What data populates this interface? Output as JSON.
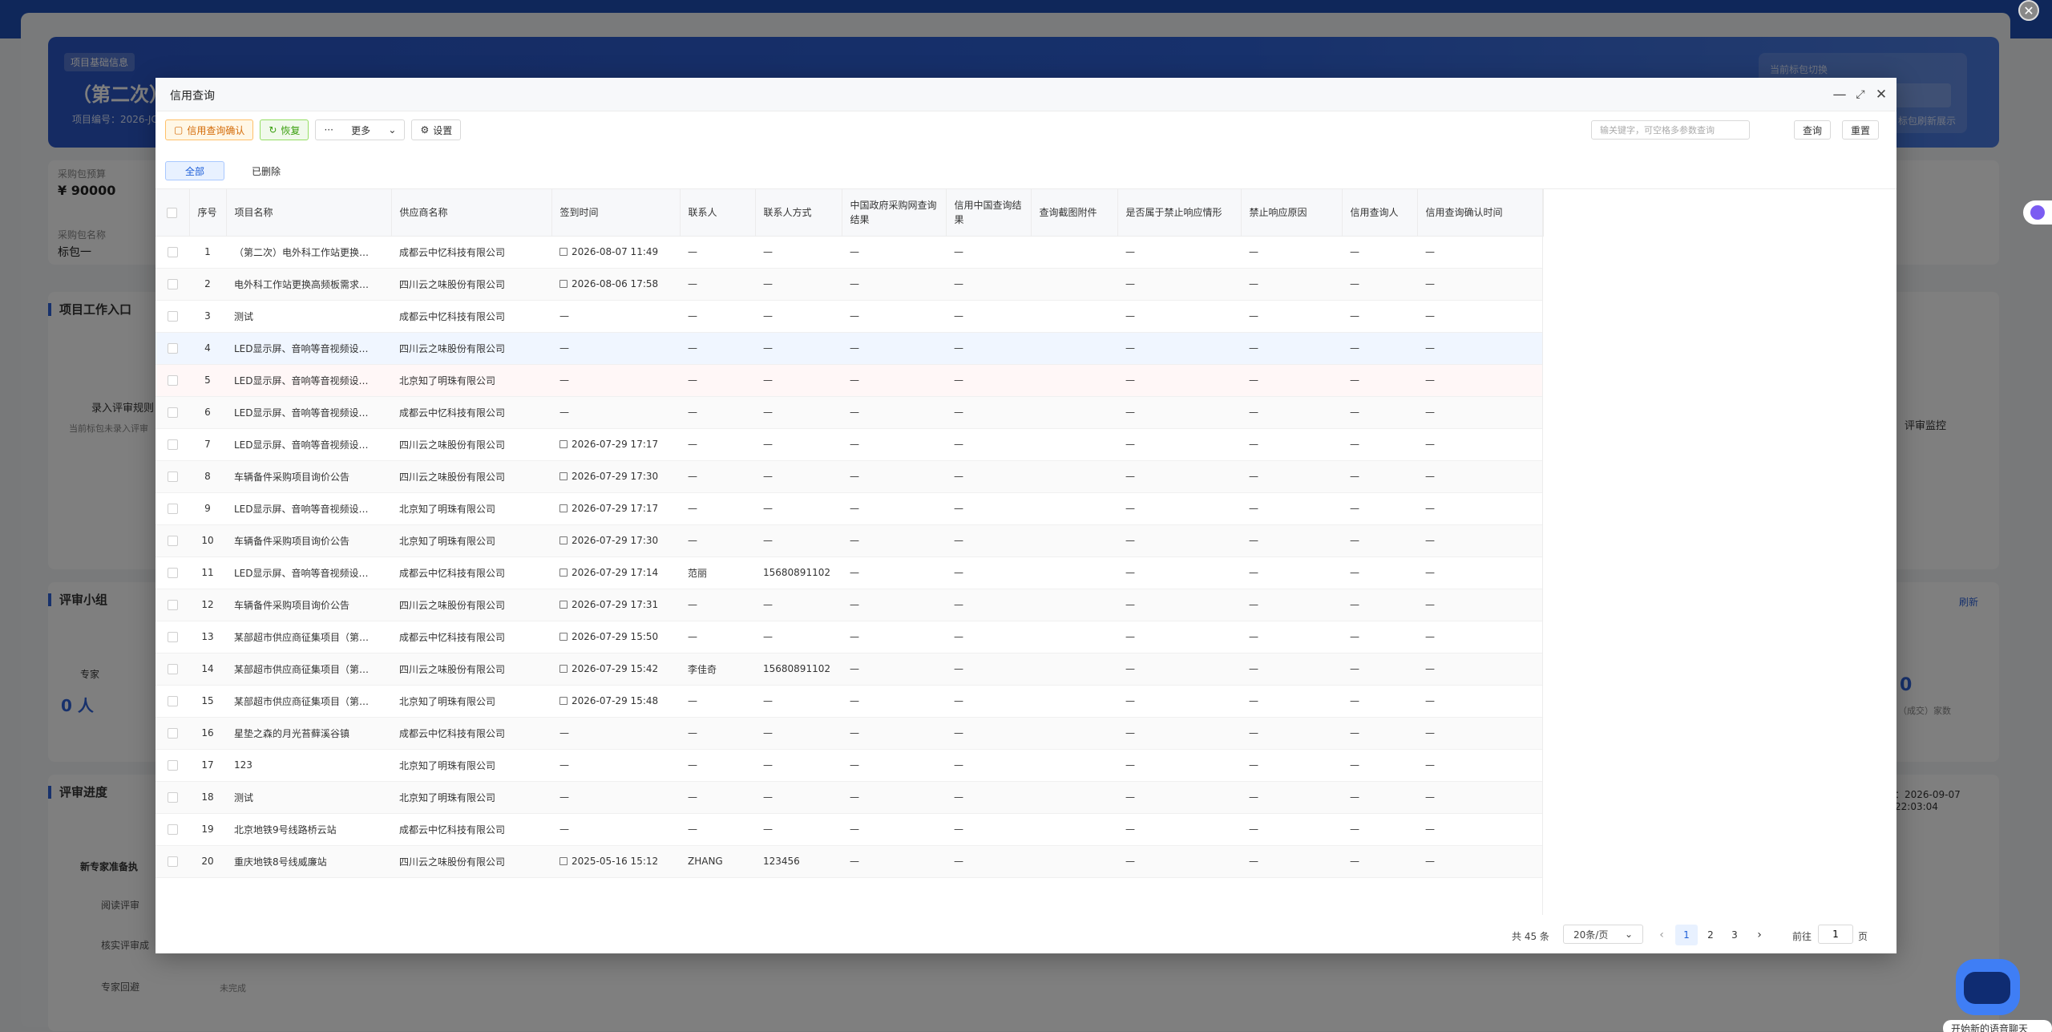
{
  "background": {
    "hero_tag": "项目基础信息",
    "hero_title": "（第二次）",
    "hero_no": "项目编号：2026-JC",
    "switch_label": "当前标包切换",
    "switch_tip": "标包刷新展示",
    "budget_label": "采购包预算",
    "budget_value": "¥ 90000",
    "pkg_label": "采购包名称",
    "pkg_value": "标包一",
    "work_entry": "项目工作入口",
    "rule_entry": "录入评审规则",
    "rule_tip": "当前标包未录入评审",
    "monitor": "评审监控",
    "group": "评审小组",
    "refresh": "刷新",
    "expert": "专家",
    "expert_count": "0 人",
    "deal_count": "0",
    "deal_label": "（成交）家数",
    "progress": "评审进度",
    "progress_time": "：2026-09-07 22:03:04",
    "ready": "新专家准备执",
    "read": "阅读评审",
    "verify": "核实评审成",
    "avoid": "专家回避",
    "not_done": "未完成"
  },
  "robot_text": "开始新的语音聊天",
  "modal": {
    "title": "信用查询",
    "toolbar": {
      "confirm": "信用查询确认",
      "restore": "恢复",
      "more": "更多",
      "settings": "设置"
    },
    "search_placeholder": "输关键字，可空格多参数查询",
    "query": "查询",
    "reset": "重置",
    "tabs": [
      "全部",
      "已删除"
    ],
    "columns": [
      "序号",
      "项目名称",
      "供应商名称",
      "签到时间",
      "联系人",
      "联系人方式",
      "中国政府采购网查询结果",
      "信用中国查询结果",
      "查询截图附件",
      "是否属于禁止响应情形",
      "禁止响应原因",
      "信用查询人",
      "信用查询确认时间"
    ],
    "rows": [
      [
        "1",
        "（第二次）电外科工作站更换…",
        "成都云中忆科技有限公司",
        "2026-08-07 11:49",
        "—",
        "—",
        "—",
        "—",
        "",
        "—",
        "—",
        "—",
        "—"
      ],
      [
        "2",
        "电外科工作站更换高频板需求…",
        "四川云之味股份有限公司",
        "2026-08-06 17:58",
        "—",
        "—",
        "—",
        "—",
        "",
        "—",
        "—",
        "—",
        "—"
      ],
      [
        "3",
        "测试",
        "成都云中忆科技有限公司",
        "—",
        "—",
        "—",
        "—",
        "—",
        "",
        "—",
        "—",
        "—",
        "—"
      ],
      [
        "4",
        "LED显示屏、音响等音视频设…",
        "四川云之味股份有限公司",
        "—",
        "—",
        "—",
        "—",
        "—",
        "",
        "—",
        "—",
        "—",
        "—"
      ],
      [
        "5",
        "LED显示屏、音响等音视频设…",
        "北京知了明珠有限公司",
        "—",
        "—",
        "—",
        "—",
        "—",
        "",
        "—",
        "—",
        "—",
        "—"
      ],
      [
        "6",
        "LED显示屏、音响等音视频设…",
        "成都云中忆科技有限公司",
        "—",
        "—",
        "—",
        "—",
        "—",
        "",
        "—",
        "—",
        "—",
        "—"
      ],
      [
        "7",
        "LED显示屏、音响等音视频设…",
        "四川云之味股份有限公司",
        "2026-07-29 17:17",
        "—",
        "—",
        "—",
        "—",
        "",
        "—",
        "—",
        "—",
        "—"
      ],
      [
        "8",
        "车辆备件采购项目询价公告",
        "四川云之味股份有限公司",
        "2026-07-29 17:30",
        "—",
        "—",
        "—",
        "—",
        "",
        "—",
        "—",
        "—",
        "—"
      ],
      [
        "9",
        "LED显示屏、音响等音视频设…",
        "北京知了明珠有限公司",
        "2026-07-29 17:17",
        "—",
        "—",
        "—",
        "—",
        "",
        "—",
        "—",
        "—",
        "—"
      ],
      [
        "10",
        "车辆备件采购项目询价公告",
        "北京知了明珠有限公司",
        "2026-07-29 17:30",
        "—",
        "—",
        "—",
        "—",
        "",
        "—",
        "—",
        "—",
        "—"
      ],
      [
        "11",
        "LED显示屏、音响等音视频设…",
        "成都云中忆科技有限公司",
        "2026-07-29 17:14",
        "范丽",
        "15680891102",
        "—",
        "—",
        "",
        "—",
        "—",
        "—",
        "—"
      ],
      [
        "12",
        "车辆备件采购项目询价公告",
        "四川云之味股份有限公司",
        "2026-07-29 17:31",
        "—",
        "—",
        "—",
        "—",
        "",
        "—",
        "—",
        "—",
        "—"
      ],
      [
        "13",
        "某部超市供应商征集项目（第…",
        "成都云中忆科技有限公司",
        "2026-07-29 15:50",
        "—",
        "—",
        "—",
        "—",
        "",
        "—",
        "—",
        "—",
        "—"
      ],
      [
        "14",
        "某部超市供应商征集项目（第…",
        "四川云之味股份有限公司",
        "2026-07-29 15:42",
        "李佳奇",
        "15680891102",
        "—",
        "—",
        "",
        "—",
        "—",
        "—",
        "—"
      ],
      [
        "15",
        "某部超市供应商征集项目（第…",
        "北京知了明珠有限公司",
        "2026-07-29 15:48",
        "—",
        "—",
        "—",
        "—",
        "",
        "—",
        "—",
        "—",
        "—"
      ],
      [
        "16",
        "星垫之森的月光苔藓溪谷镇",
        "成都云中忆科技有限公司",
        "—",
        "—",
        "—",
        "—",
        "—",
        "",
        "—",
        "—",
        "—",
        "—"
      ],
      [
        "17",
        "123",
        "北京知了明珠有限公司",
        "—",
        "—",
        "—",
        "—",
        "—",
        "",
        "—",
        "—",
        "—",
        "—"
      ],
      [
        "18",
        "测试",
        "北京知了明珠有限公司",
        "—",
        "—",
        "—",
        "—",
        "—",
        "",
        "—",
        "—",
        "—",
        "—"
      ],
      [
        "19",
        "北京地铁9号线路桥云站",
        "成都云中忆科技有限公司",
        "—",
        "—",
        "—",
        "—",
        "—",
        "",
        "—",
        "—",
        "—",
        "—"
      ],
      [
        "20",
        "重庆地铁8号线威廉站",
        "四川云之味股份有限公司",
        "2025-05-16 15:12",
        "ZHANG",
        "123456",
        "—",
        "—",
        "",
        "—",
        "—",
        "—",
        "—"
      ]
    ],
    "pager": {
      "total": "共 45 条",
      "size": "20条/页",
      "pages": [
        "1",
        "2",
        "3"
      ],
      "goto": "前往",
      "goto_value": "1",
      "page_unit": "页"
    }
  }
}
